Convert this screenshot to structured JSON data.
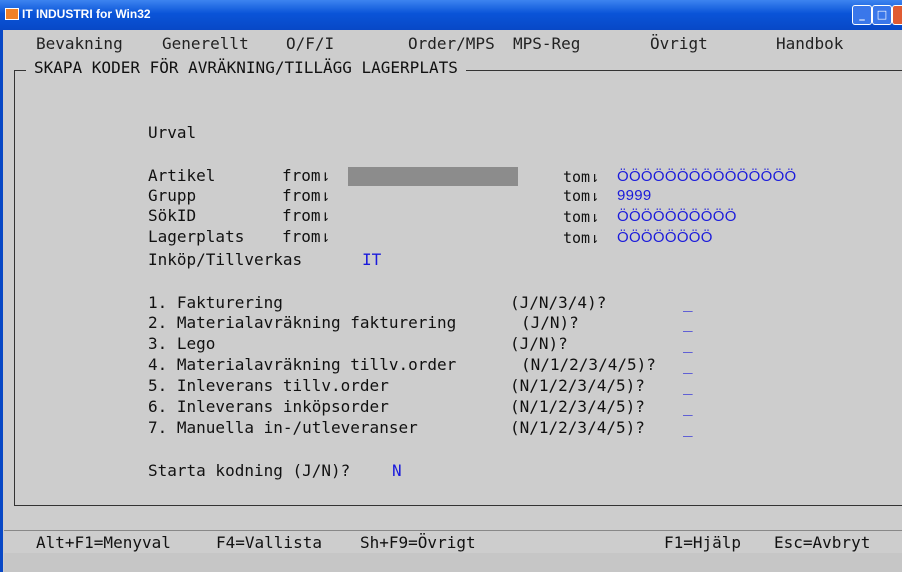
{
  "window": {
    "title": "IT INDUSTRI for Win32",
    "icon": "app-icon",
    "buttons": {
      "minimize": "_",
      "maximize": "□",
      "close": "×"
    }
  },
  "menu": {
    "items": [
      "Bevakning",
      "Generellt",
      "O/F/I",
      "Order/MPS",
      "MPS-Reg",
      "Övrigt",
      "Handbok"
    ]
  },
  "screen": {
    "title": "SKAPA KODER FÖR AVRÄKNING/TILLÄGG LAGERPLATS",
    "section_label": "Urval",
    "range_fields": [
      {
        "label": "Artikel",
        "from_label": "from⇂",
        "from_value": "",
        "tom_label": "tom⇂",
        "tom_value": "ÖÖÖÖÖÖÖÖÖÖÖÖÖÖÖ"
      },
      {
        "label": "Grupp",
        "from_label": "from⇂",
        "from_value": "",
        "tom_label": "tom⇂",
        "tom_value": "9999"
      },
      {
        "label": "SökID",
        "from_label": "from⇂",
        "from_value": "",
        "tom_label": "tom⇂",
        "tom_value": "ÖÖÖÖÖÖÖÖÖÖ"
      },
      {
        "label": "Lagerplats",
        "from_label": "from⇂",
        "from_value": "",
        "tom_label": "tom⇂",
        "tom_value": "ÖÖÖÖÖÖÖÖ"
      }
    ],
    "inkop": {
      "label": "Inköp/Tillverkas",
      "value": "IT"
    },
    "options": [
      {
        "label": "1. Fakturering",
        "choices": "(J/N/3/4)?",
        "value": "_"
      },
      {
        "label": "2. Materialavräkning fakturering",
        "choices": "(J/N)?",
        "value": "_"
      },
      {
        "label": "3. Lego",
        "choices": "(J/N)?",
        "value": "_"
      },
      {
        "label": "4. Materialavräkning tillv.order",
        "choices": "(N/1/2/3/4/5)?",
        "value": "_"
      },
      {
        "label": "5. Inleverans tillv.order",
        "choices": "(N/1/2/3/4/5)?",
        "value": "_"
      },
      {
        "label": "6. Inleverans inköpsorder",
        "choices": "(N/1/2/3/4/5)?",
        "value": "_"
      },
      {
        "label": "7. Manuella in-/utleveranser",
        "choices": "(N/1/2/3/4/5)?",
        "value": "_"
      }
    ],
    "start": {
      "label": "Starta kodning (J/N)?",
      "value": "N"
    }
  },
  "statusbar": {
    "menyval": "Alt+F1=Menyval",
    "vallista": "F4=Vallista",
    "ovrigt": "Sh+F9=Övrigt",
    "hjalp": "F1=Hjälp",
    "avbryt": "Esc=Avbryt"
  },
  "colors": {
    "titlebar": "#0a54d8",
    "value_text": "#1a1adb",
    "background": "#cdcdcd",
    "shaded_field": "#8c8c8c"
  }
}
